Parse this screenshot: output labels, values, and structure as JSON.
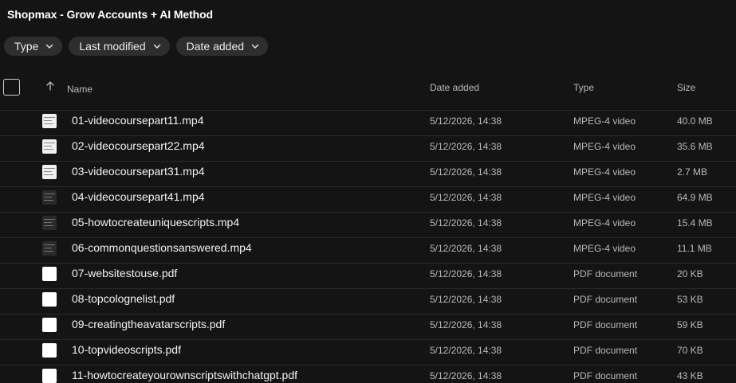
{
  "header": {
    "title": "Shopmax - Grow Accounts + AI Method"
  },
  "filters": [
    {
      "label": "Type"
    },
    {
      "label": "Last modified"
    },
    {
      "label": "Date added"
    }
  ],
  "columns": {
    "name": "Name",
    "date_added": "Date added",
    "type": "Type",
    "size": "Size"
  },
  "files": [
    {
      "name": "01-videocoursepart11.mp4",
      "date": "5/12/2026, 14:38",
      "type": "MPEG-4 video",
      "size": "40.0 MB",
      "thumb": "vid-light"
    },
    {
      "name": "02-videocoursepart22.mp4",
      "date": "5/12/2026, 14:38",
      "type": "MPEG-4 video",
      "size": "35.6 MB",
      "thumb": "vid-light"
    },
    {
      "name": "03-videocoursepart31.mp4",
      "date": "5/12/2026, 14:38",
      "type": "MPEG-4 video",
      "size": "2.7 MB",
      "thumb": "vid-light"
    },
    {
      "name": "04-videocoursepart41.mp4",
      "date": "5/12/2026, 14:38",
      "type": "MPEG-4 video",
      "size": "64.9 MB",
      "thumb": "vid-dark"
    },
    {
      "name": "05-howtocreateuniquescripts.mp4",
      "date": "5/12/2026, 14:38",
      "type": "MPEG-4 video",
      "size": "15.4 MB",
      "thumb": "vid-dark"
    },
    {
      "name": "06-commonquestionsanswered.mp4",
      "date": "5/12/2026, 14:38",
      "type": "MPEG-4 video",
      "size": "11.1 MB",
      "thumb": "vid-dark"
    },
    {
      "name": "07-websitestouse.pdf",
      "date": "5/12/2026, 14:38",
      "type": "PDF document",
      "size": "20 KB",
      "thumb": "pdf"
    },
    {
      "name": "08-topcolognelist.pdf",
      "date": "5/12/2026, 14:38",
      "type": "PDF document",
      "size": "53 KB",
      "thumb": "pdf"
    },
    {
      "name": "09-creatingtheavatarscripts.pdf",
      "date": "5/12/2026, 14:38",
      "type": "PDF document",
      "size": "59 KB",
      "thumb": "pdf"
    },
    {
      "name": "10-topvideoscripts.pdf",
      "date": "5/12/2026, 14:38",
      "type": "PDF document",
      "size": "70 KB",
      "thumb": "pdf"
    },
    {
      "name": "11-howtocreateyourownscriptswithchatgpt.pdf",
      "date": "5/12/2026, 14:38",
      "type": "PDF document",
      "size": "43 KB",
      "thumb": "pdf"
    }
  ],
  "icons": {
    "chip_chevron": "chevron-down-icon",
    "sort": "arrow-up-icon",
    "select_all": "checkbox-icon"
  },
  "colors": {
    "background": "#141414",
    "chip": "#2e2e2e",
    "divider": "#2a2a2a"
  }
}
